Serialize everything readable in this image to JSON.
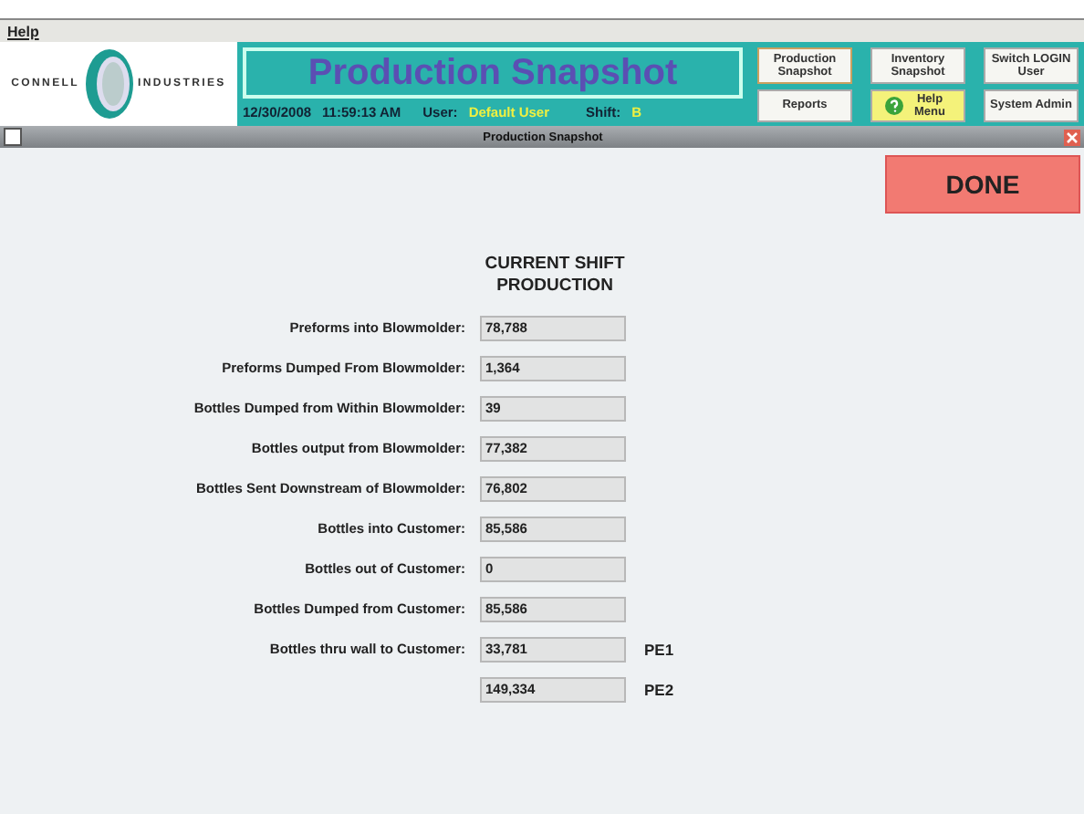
{
  "menu": [
    "Help"
  ],
  "logo": {
    "left": "CONNELL",
    "right": "INDUSTRIES"
  },
  "header": {
    "title": "Production Snapshot",
    "date": "12/30/2008",
    "time": "11:59:13 AM",
    "user_label": "User:",
    "user": "Default User",
    "shift_label": "Shift:",
    "shift": "B"
  },
  "nav_buttons": [
    {
      "label": "Production Snapshot",
      "selected": true,
      "kind": "plain"
    },
    {
      "label": "Reports",
      "selected": false,
      "kind": "plain"
    },
    {
      "label": "Inventory Snapshot",
      "selected": false,
      "kind": "plain"
    },
    {
      "label": "Help Menu",
      "selected": false,
      "kind": "help"
    },
    {
      "label": "Switch LOGIN User",
      "selected": false,
      "kind": "plain"
    },
    {
      "label": "System Admin",
      "selected": false,
      "kind": "plain"
    }
  ],
  "window": {
    "title": "Production Snapshot",
    "checked": false
  },
  "done_button": "DONE",
  "section_title": "CURRENT SHIFT PRODUCTION",
  "rows": [
    {
      "label": "Preforms into Blowmolder:",
      "value": "78,788"
    },
    {
      "label": "Preforms Dumped From Blowmolder:",
      "value": "1,364"
    },
    {
      "label": "Bottles Dumped from Within Blowmolder:",
      "value": "39"
    },
    {
      "label": "Bottles output from Blowmolder:",
      "value": "77,382"
    },
    {
      "label": "Bottles Sent Downstream of Blowmolder:",
      "value": "76,802"
    },
    {
      "label": "Bottles into  Customer:",
      "value": "85,586"
    },
    {
      "label": "Bottles out of  Customer:",
      "value": "0"
    },
    {
      "label": "Bottles Dumped from  Customer:",
      "value": "85,586"
    },
    {
      "label": "Bottles thru wall to  Customer:",
      "value": "33,781",
      "suffix": "PE1"
    },
    {
      "value": "149,334",
      "suffix": "PE2"
    }
  ]
}
